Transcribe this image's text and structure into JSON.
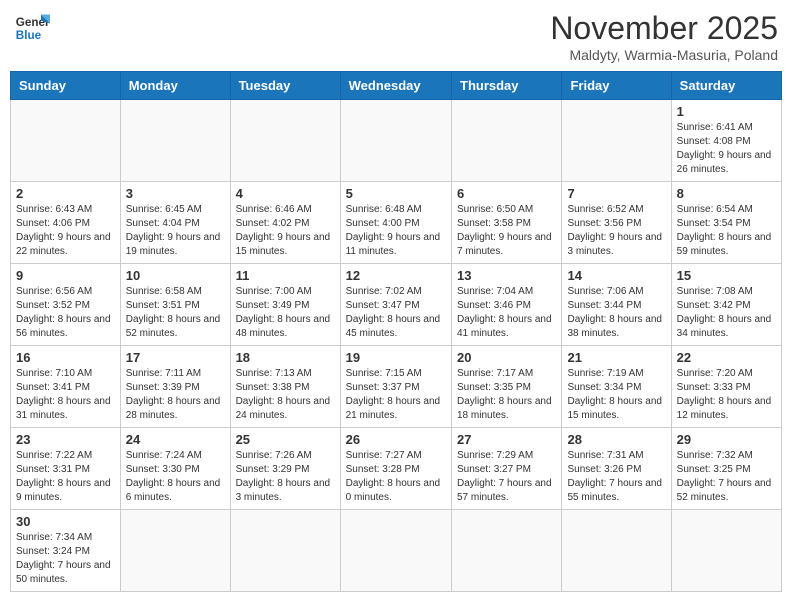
{
  "logo": {
    "line1": "General",
    "line2": "Blue"
  },
  "title": "November 2025",
  "location": "Maldyty, Warmia-Masuria, Poland",
  "weekdays": [
    "Sunday",
    "Monday",
    "Tuesday",
    "Wednesday",
    "Thursday",
    "Friday",
    "Saturday"
  ],
  "weeks": [
    [
      {
        "day": "",
        "info": ""
      },
      {
        "day": "",
        "info": ""
      },
      {
        "day": "",
        "info": ""
      },
      {
        "day": "",
        "info": ""
      },
      {
        "day": "",
        "info": ""
      },
      {
        "day": "",
        "info": ""
      },
      {
        "day": "1",
        "info": "Sunrise: 6:41 AM\nSunset: 4:08 PM\nDaylight: 9 hours and 26 minutes."
      }
    ],
    [
      {
        "day": "2",
        "info": "Sunrise: 6:43 AM\nSunset: 4:06 PM\nDaylight: 9 hours and 22 minutes."
      },
      {
        "day": "3",
        "info": "Sunrise: 6:45 AM\nSunset: 4:04 PM\nDaylight: 9 hours and 19 minutes."
      },
      {
        "day": "4",
        "info": "Sunrise: 6:46 AM\nSunset: 4:02 PM\nDaylight: 9 hours and 15 minutes."
      },
      {
        "day": "5",
        "info": "Sunrise: 6:48 AM\nSunset: 4:00 PM\nDaylight: 9 hours and 11 minutes."
      },
      {
        "day": "6",
        "info": "Sunrise: 6:50 AM\nSunset: 3:58 PM\nDaylight: 9 hours and 7 minutes."
      },
      {
        "day": "7",
        "info": "Sunrise: 6:52 AM\nSunset: 3:56 PM\nDaylight: 9 hours and 3 minutes."
      },
      {
        "day": "8",
        "info": "Sunrise: 6:54 AM\nSunset: 3:54 PM\nDaylight: 8 hours and 59 minutes."
      }
    ],
    [
      {
        "day": "9",
        "info": "Sunrise: 6:56 AM\nSunset: 3:52 PM\nDaylight: 8 hours and 56 minutes."
      },
      {
        "day": "10",
        "info": "Sunrise: 6:58 AM\nSunset: 3:51 PM\nDaylight: 8 hours and 52 minutes."
      },
      {
        "day": "11",
        "info": "Sunrise: 7:00 AM\nSunset: 3:49 PM\nDaylight: 8 hours and 48 minutes."
      },
      {
        "day": "12",
        "info": "Sunrise: 7:02 AM\nSunset: 3:47 PM\nDaylight: 8 hours and 45 minutes."
      },
      {
        "day": "13",
        "info": "Sunrise: 7:04 AM\nSunset: 3:46 PM\nDaylight: 8 hours and 41 minutes."
      },
      {
        "day": "14",
        "info": "Sunrise: 7:06 AM\nSunset: 3:44 PM\nDaylight: 8 hours and 38 minutes."
      },
      {
        "day": "15",
        "info": "Sunrise: 7:08 AM\nSunset: 3:42 PM\nDaylight: 8 hours and 34 minutes."
      }
    ],
    [
      {
        "day": "16",
        "info": "Sunrise: 7:10 AM\nSunset: 3:41 PM\nDaylight: 8 hours and 31 minutes."
      },
      {
        "day": "17",
        "info": "Sunrise: 7:11 AM\nSunset: 3:39 PM\nDaylight: 8 hours and 28 minutes."
      },
      {
        "day": "18",
        "info": "Sunrise: 7:13 AM\nSunset: 3:38 PM\nDaylight: 8 hours and 24 minutes."
      },
      {
        "day": "19",
        "info": "Sunrise: 7:15 AM\nSunset: 3:37 PM\nDaylight: 8 hours and 21 minutes."
      },
      {
        "day": "20",
        "info": "Sunrise: 7:17 AM\nSunset: 3:35 PM\nDaylight: 8 hours and 18 minutes."
      },
      {
        "day": "21",
        "info": "Sunrise: 7:19 AM\nSunset: 3:34 PM\nDaylight: 8 hours and 15 minutes."
      },
      {
        "day": "22",
        "info": "Sunrise: 7:20 AM\nSunset: 3:33 PM\nDaylight: 8 hours and 12 minutes."
      }
    ],
    [
      {
        "day": "23",
        "info": "Sunrise: 7:22 AM\nSunset: 3:31 PM\nDaylight: 8 hours and 9 minutes."
      },
      {
        "day": "24",
        "info": "Sunrise: 7:24 AM\nSunset: 3:30 PM\nDaylight: 8 hours and 6 minutes."
      },
      {
        "day": "25",
        "info": "Sunrise: 7:26 AM\nSunset: 3:29 PM\nDaylight: 8 hours and 3 minutes."
      },
      {
        "day": "26",
        "info": "Sunrise: 7:27 AM\nSunset: 3:28 PM\nDaylight: 8 hours and 0 minutes."
      },
      {
        "day": "27",
        "info": "Sunrise: 7:29 AM\nSunset: 3:27 PM\nDaylight: 7 hours and 57 minutes."
      },
      {
        "day": "28",
        "info": "Sunrise: 7:31 AM\nSunset: 3:26 PM\nDaylight: 7 hours and 55 minutes."
      },
      {
        "day": "29",
        "info": "Sunrise: 7:32 AM\nSunset: 3:25 PM\nDaylight: 7 hours and 52 minutes."
      }
    ],
    [
      {
        "day": "30",
        "info": "Sunrise: 7:34 AM\nSunset: 3:24 PM\nDaylight: 7 hours and 50 minutes."
      },
      {
        "day": "",
        "info": ""
      },
      {
        "day": "",
        "info": ""
      },
      {
        "day": "",
        "info": ""
      },
      {
        "day": "",
        "info": ""
      },
      {
        "day": "",
        "info": ""
      },
      {
        "day": "",
        "info": ""
      }
    ]
  ]
}
